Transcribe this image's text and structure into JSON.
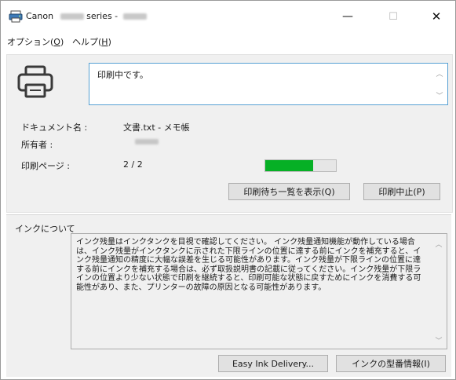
{
  "window": {
    "title_prefix": "Canon",
    "title_middle": "series -",
    "minimize_glyph": "—",
    "maximize_glyph": "☐",
    "close_glyph": "✕"
  },
  "menu": {
    "options_label": "オプション(",
    "options_accel": "O",
    "options_suffix": ")",
    "help_label": "ヘルプ(",
    "help_accel": "H",
    "help_suffix": ")"
  },
  "status": {
    "message": "印刷中です。",
    "scroll_up": "︿",
    "scroll_down": "﹀"
  },
  "info": {
    "document_label": "ドキュメント名 :",
    "document_value": "文書.txt - メモ帳",
    "owner_label": "所有者 :",
    "pages_label": "印刷ページ :",
    "pages_value": "2 / 2",
    "progress_fraction": 0.68
  },
  "buttons": {
    "queue": "印刷待ち一覧を表示(Q)",
    "cancel": "印刷中止(P)",
    "easy_ink": "Easy Ink Delivery...",
    "ink_model": "インクの型番情報(I)"
  },
  "ink": {
    "section_title": "インクについて",
    "text": "インク残量はインクタンクを目視で確認してください。\nインク残量通知機能が動作している場合は、インク残量がインクタンクに示された下限ラインの位置に達する前にインクを補充すると、インク残量通知の精度に大幅な誤差を生じる可能性があります。インク残量が下限ラインの位置に達する前にインクを補充する場合は、必ず取扱説明書の記載に従ってください。インク残量が下限ラインの位置より少ない状態で印刷を継続すると、印刷可能な状態に戻すためにインクを消費する可能性があり、また、プリンターの故障の原因となる可能性があります。"
  },
  "colors": {
    "progress": "#06b025",
    "status_border": "#56a0d3"
  }
}
